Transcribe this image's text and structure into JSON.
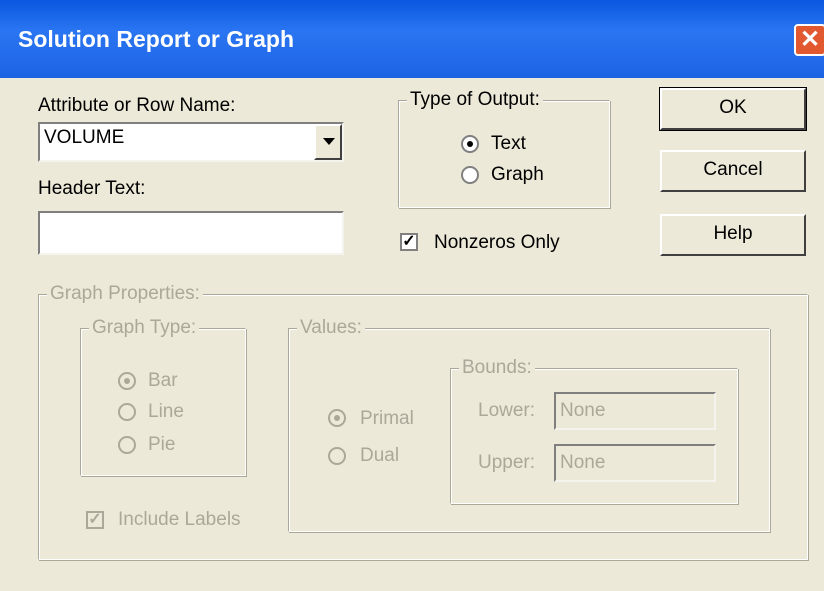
{
  "window": {
    "title": "Solution Report or Graph",
    "close_symbol": "✕"
  },
  "attribute": {
    "label": "Attribute or Row Name:",
    "value": "VOLUME"
  },
  "header": {
    "label": "Header Text:",
    "value": ""
  },
  "output": {
    "label": "Type of Output:",
    "text_option": "Text",
    "graph_option": "Graph",
    "selected": "Text"
  },
  "nonzeros": {
    "label": "Nonzeros Only",
    "checked": true
  },
  "buttons": {
    "ok": "OK",
    "cancel": "Cancel",
    "help": "Help"
  },
  "graph_properties": {
    "label": "Graph Properties:",
    "graph_type": {
      "label": "Graph Type:",
      "options": [
        "Bar",
        "Line",
        "Pie"
      ],
      "selected": "Bar"
    },
    "include_labels": {
      "label": "Include Labels",
      "checked": true
    },
    "values": {
      "label": "Values:",
      "options": [
        "Primal",
        "Dual"
      ],
      "selected": "Primal",
      "bounds": {
        "label": "Bounds:",
        "lower_label": "Lower:",
        "lower_value": "None",
        "upper_label": "Upper:",
        "upper_value": "None"
      }
    }
  }
}
